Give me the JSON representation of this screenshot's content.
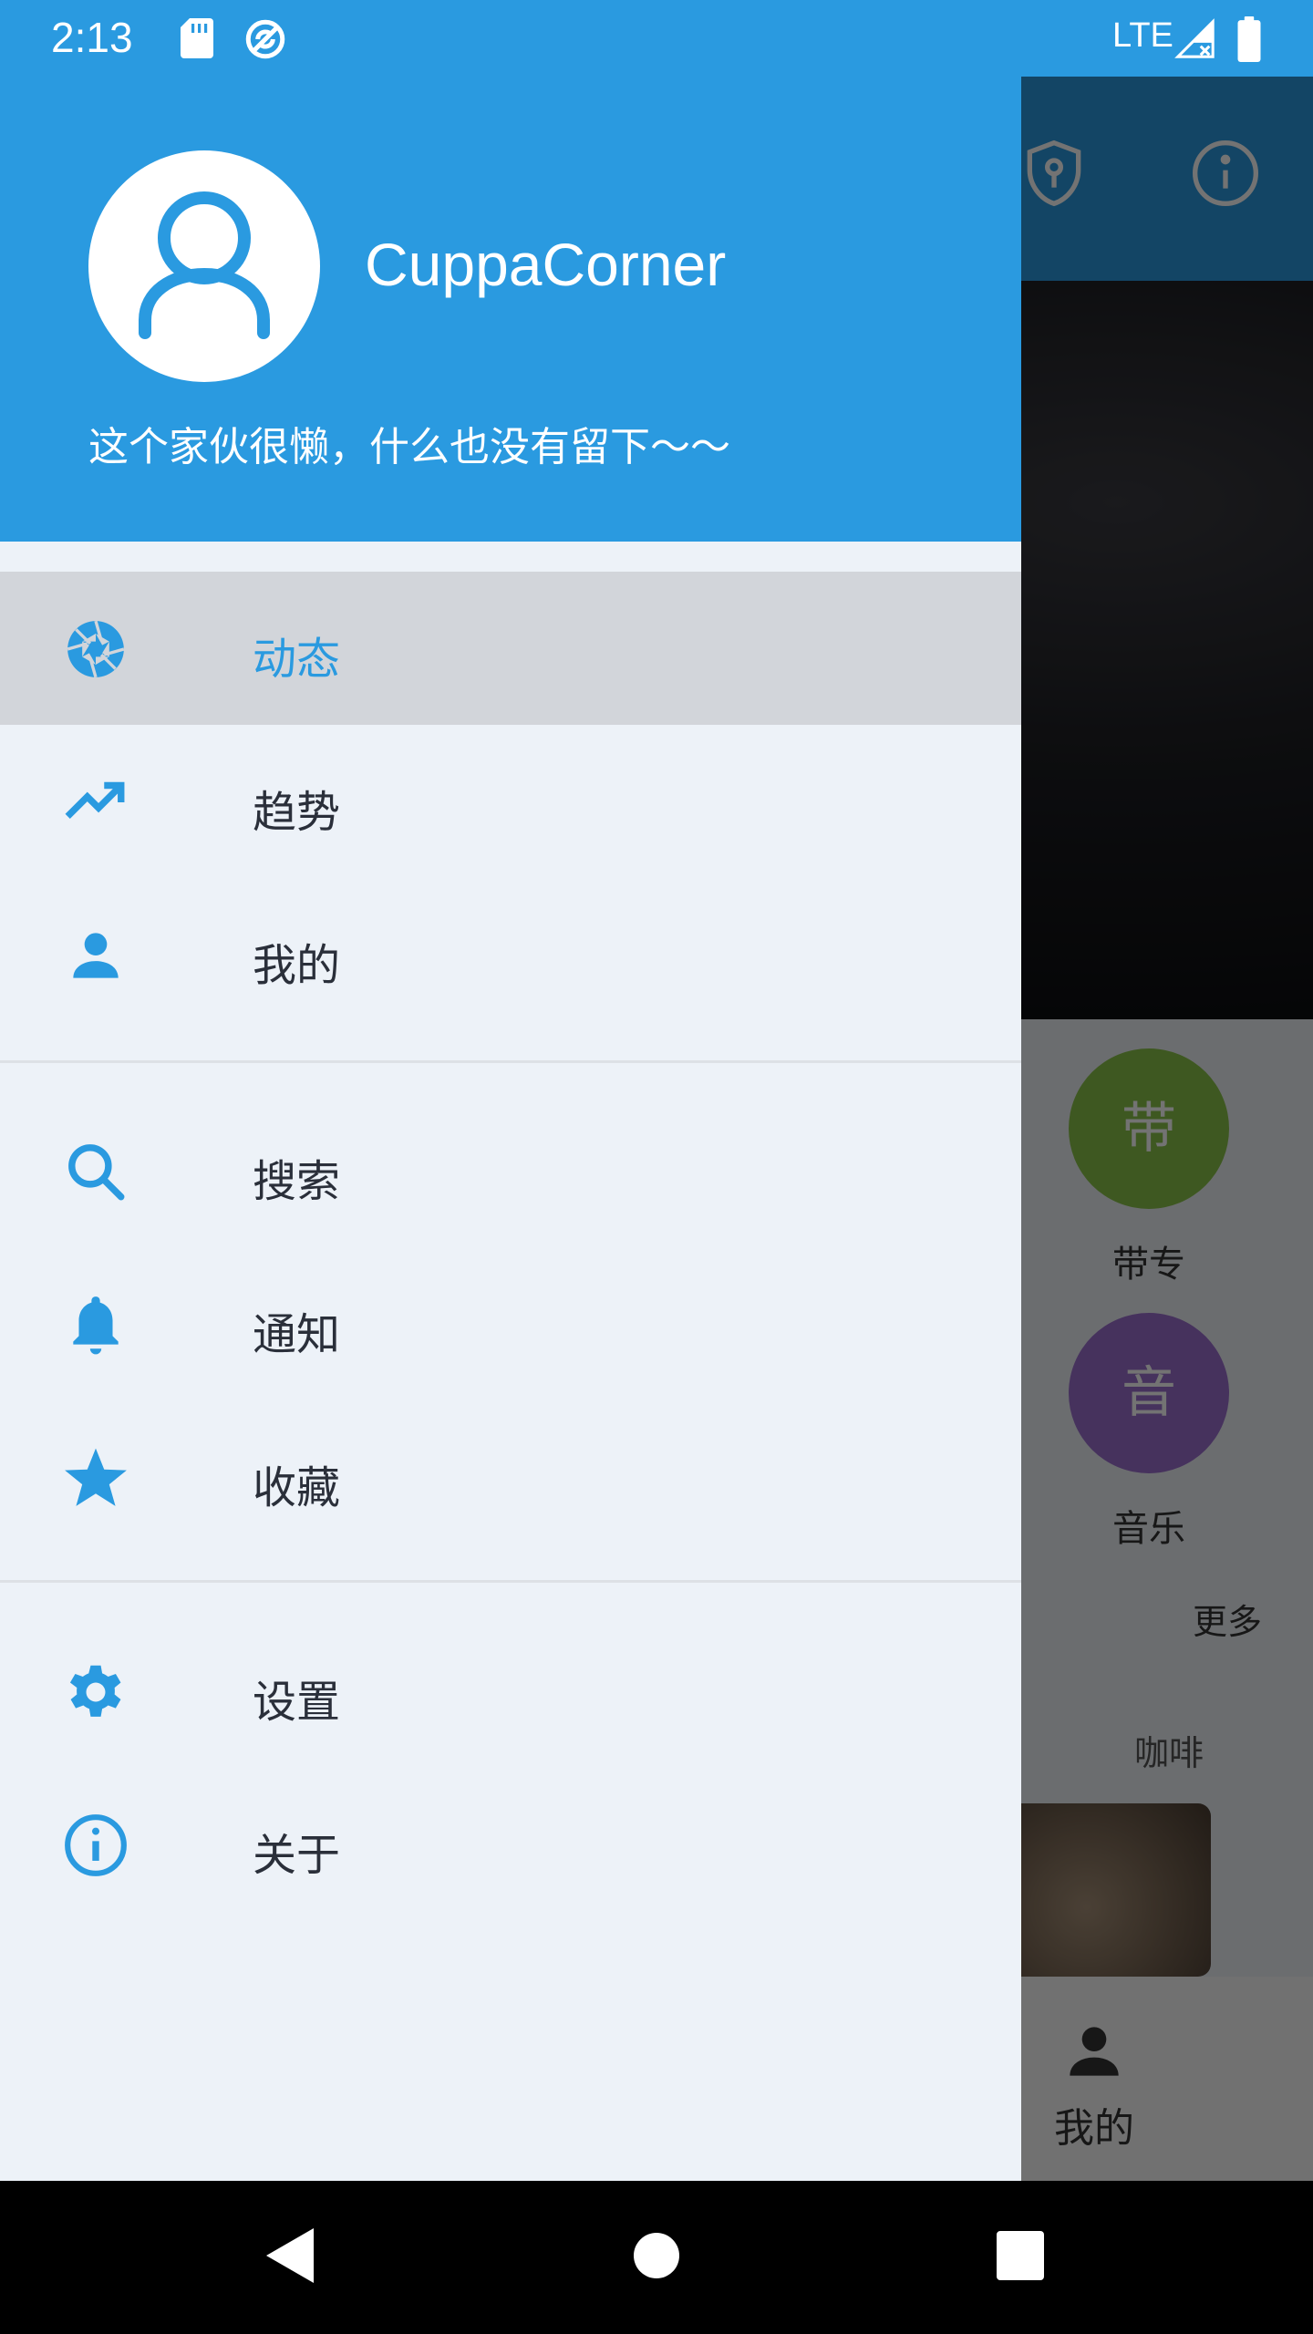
{
  "status_bar": {
    "time": "2:13",
    "network": "LTE",
    "icons": [
      "sd-card-icon",
      "sync-icon",
      "signal-icon",
      "battery-icon"
    ]
  },
  "drawer": {
    "header": {
      "username": "CuppaCorner",
      "bio": "这个家伙很懒，什么也没有留下～～",
      "avatar_icon": "person-outline-icon"
    },
    "sections": [
      {
        "items": [
          {
            "label": "动态",
            "icon": "aperture-icon",
            "active": true
          },
          {
            "label": "趋势",
            "icon": "trending-up-icon",
            "active": false
          },
          {
            "label": "我的",
            "icon": "person-icon",
            "active": false
          }
        ]
      },
      {
        "items": [
          {
            "label": "搜索",
            "icon": "search-icon",
            "active": false
          },
          {
            "label": "通知",
            "icon": "bell-icon",
            "active": false
          },
          {
            "label": "收藏",
            "icon": "star-icon",
            "active": false
          }
        ]
      },
      {
        "items": [
          {
            "label": "设置",
            "icon": "gear-icon",
            "active": false
          },
          {
            "label": "关于",
            "icon": "info-icon",
            "active": false
          }
        ]
      }
    ]
  },
  "background_app": {
    "toolbar_icons": [
      "shield-key-icon",
      "info-icon"
    ],
    "categories": [
      {
        "badge": "带",
        "label": "带专",
        "color": "#8bc34a"
      },
      {
        "badge": "音",
        "label": "音乐",
        "color": "#9c6fcf"
      }
    ],
    "more_label": "更多",
    "section_label": "咖啡",
    "bottom_nav_label": "我的"
  },
  "colors": {
    "primary": "#2a9ae0",
    "drawer_bg": "#edf2f8",
    "active_item_bg": "#d2d5da"
  }
}
